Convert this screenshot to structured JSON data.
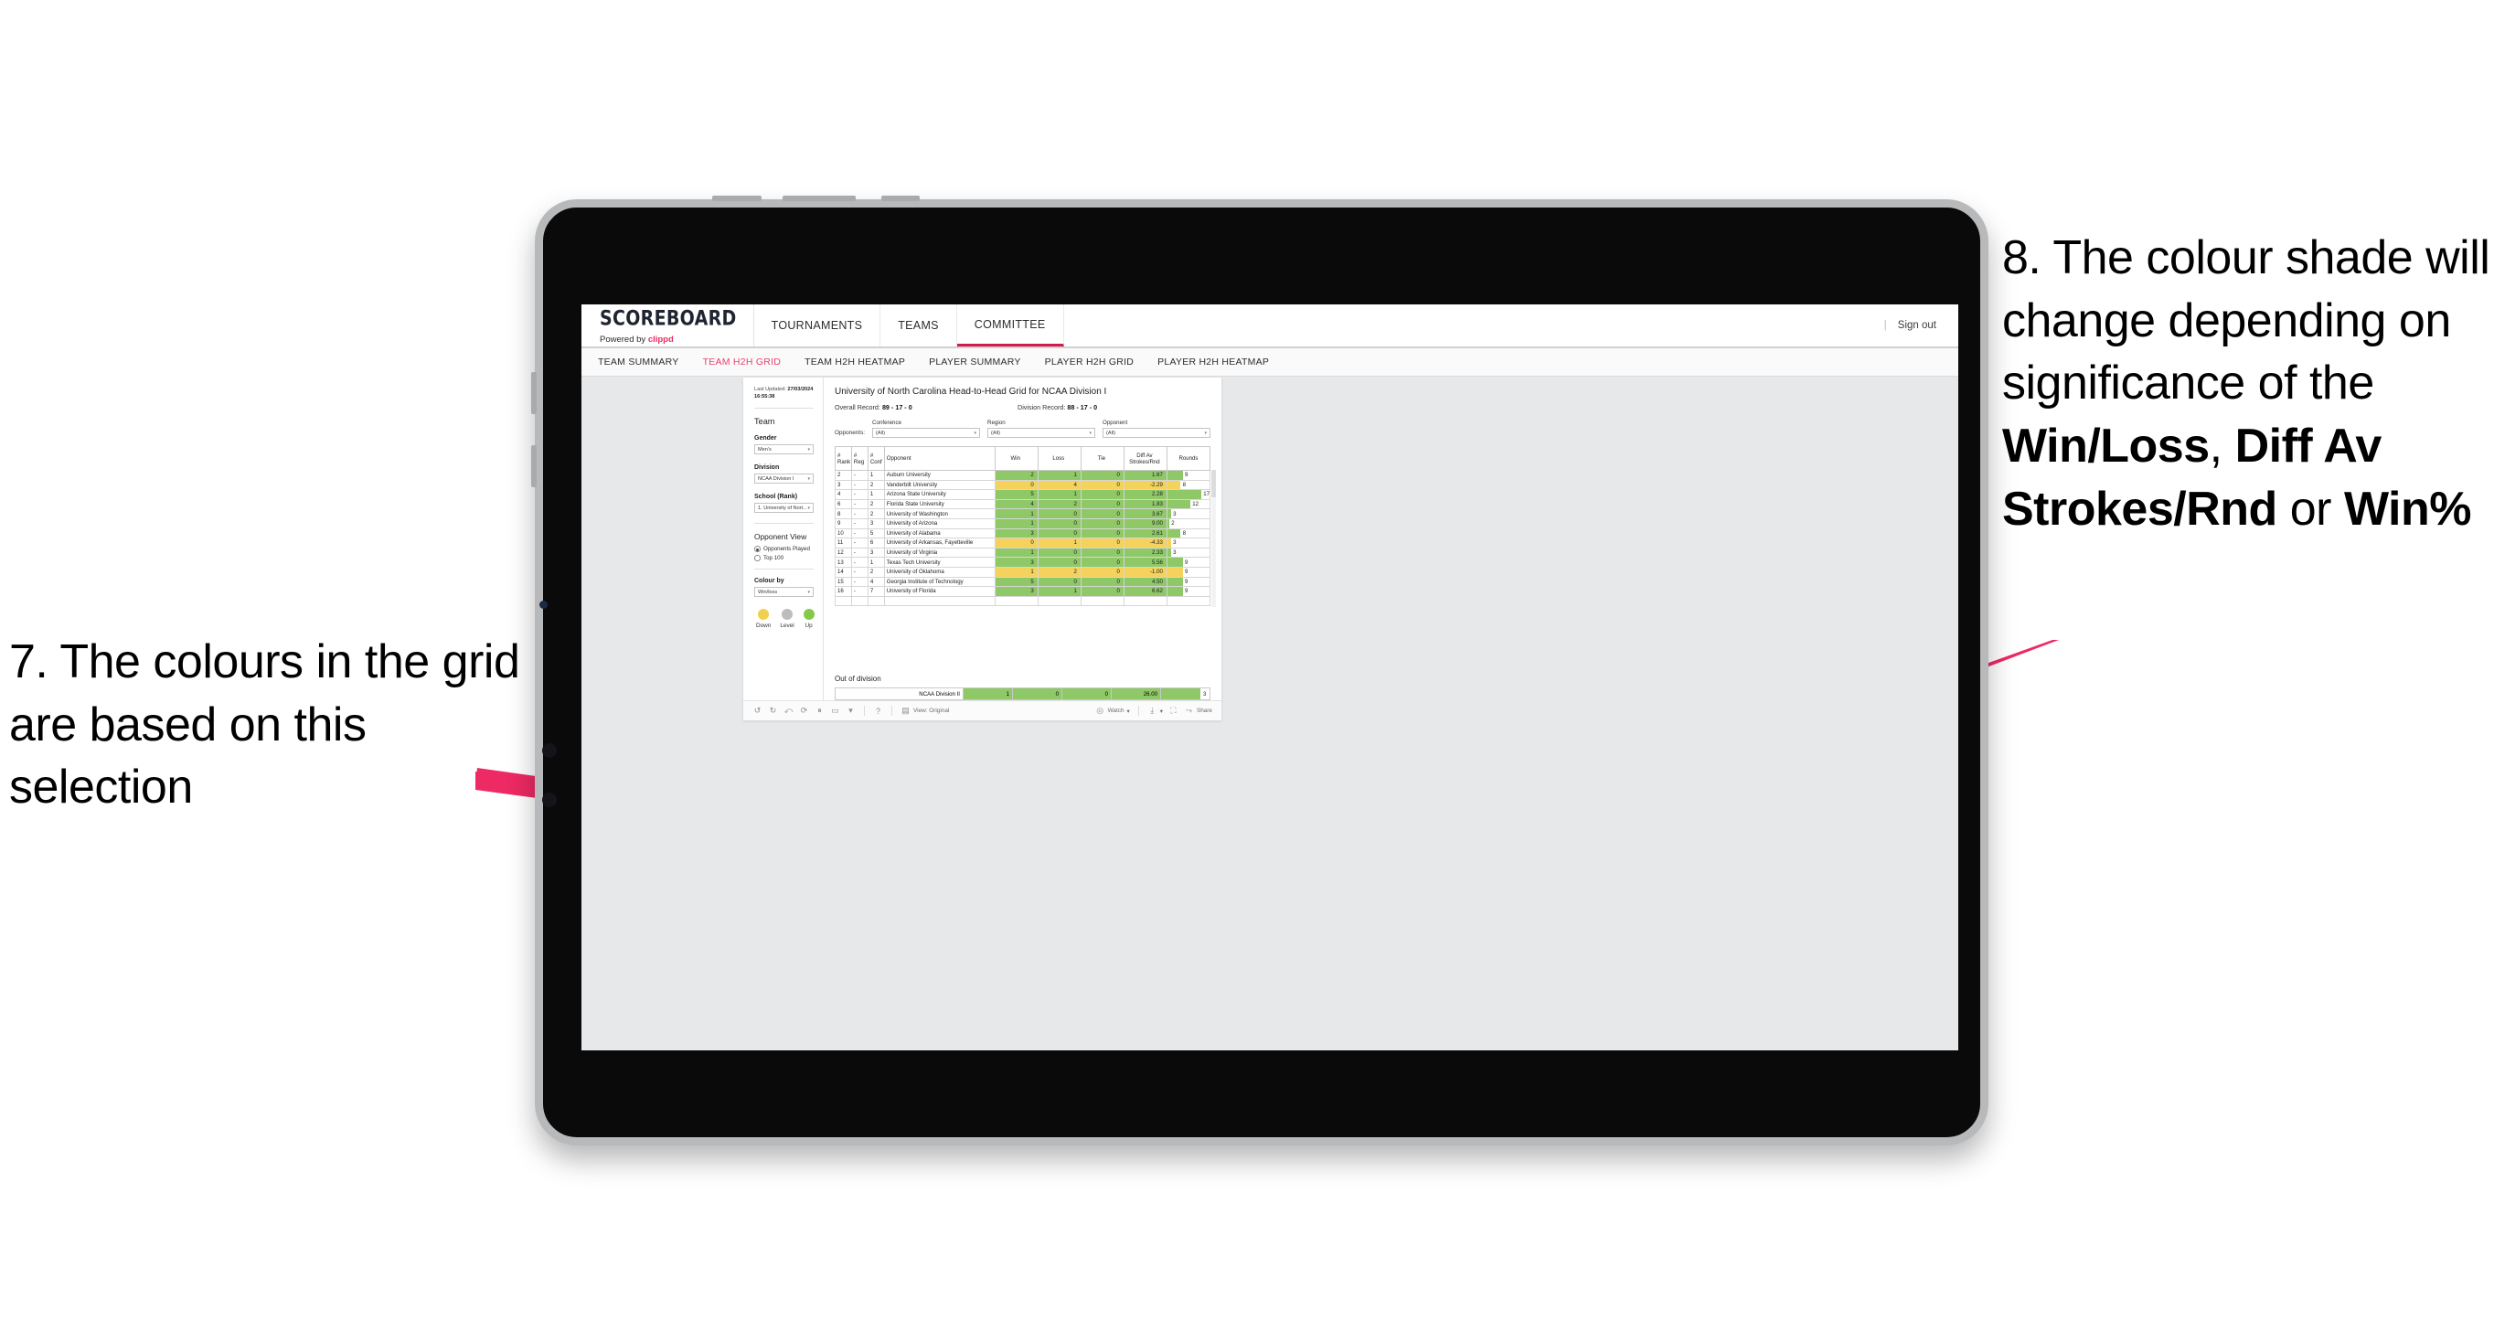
{
  "annotations": {
    "left": "7. The colours in the grid are based on this selection",
    "right_prefix": "8. The colour shade will change depending on significance of the ",
    "right_bold1": "Win/Loss",
    "right_mid1": ", ",
    "right_bold2": "Diff Av Strokes/Rnd",
    "right_mid2": " or ",
    "right_bold3": "Win%",
    "arrow_color": "#ED2A63"
  },
  "topnav": {
    "brand_title": "SCOREBOARD",
    "brand_sub_prefix": "Powered by ",
    "brand_sub_brand": "clippd",
    "items": [
      {
        "label": "TOURNAMENTS",
        "active": false
      },
      {
        "label": "TEAMS",
        "active": false
      },
      {
        "label": "COMMITTEE",
        "active": true
      }
    ],
    "divider": "|",
    "sign_out": "Sign out"
  },
  "subnav": {
    "items": [
      {
        "label": "TEAM SUMMARY",
        "active": false
      },
      {
        "label": "TEAM H2H GRID",
        "active": true
      },
      {
        "label": "TEAM H2H HEATMAP",
        "active": false
      },
      {
        "label": "PLAYER SUMMARY",
        "active": false
      },
      {
        "label": "PLAYER H2H GRID",
        "active": false
      },
      {
        "label": "PLAYER H2H HEATMAP",
        "active": false
      }
    ]
  },
  "sidebar": {
    "last_updated_label": "Last Updated: ",
    "last_updated_value": "27/03/2024 16:55:38",
    "team_heading": "Team",
    "gender_label": "Gender",
    "gender_value": "Men's",
    "division_label": "Division",
    "division_value": "NCAA Division I",
    "school_label": "School (Rank)",
    "school_value": "1. University of Nort...",
    "opponent_view_heading": "Opponent View",
    "opponent_view_options": [
      {
        "label": "Opponents Played",
        "selected": true
      },
      {
        "label": "Top 100",
        "selected": false
      }
    ],
    "colour_by_label": "Colour by",
    "colour_by_value": "Win/loss",
    "legend": [
      {
        "label": "Down",
        "color": "#F2D04F"
      },
      {
        "label": "Level",
        "color": "#BDBDBD"
      },
      {
        "label": "Up",
        "color": "#86C94A"
      }
    ]
  },
  "main": {
    "title": "University of North Carolina Head-to-Head Grid for NCAA Division I",
    "overall_record_label": "Overall Record: ",
    "overall_record_value": "89 - 17 - 0",
    "division_record_label": "Division Record: ",
    "division_record_value": "88 - 17 - 0",
    "opponents_label": "Opponents:",
    "filters": [
      {
        "label": "Conference",
        "value": "(All)"
      },
      {
        "label": "Region",
        "value": "(All)"
      },
      {
        "label": "Opponent",
        "value": "(All)"
      }
    ],
    "columns": [
      "# Rank",
      "# Reg",
      "# Conf",
      "Opponent",
      "Win",
      "Loss",
      "Tie",
      "Diff Av Strokes/Rnd",
      "Rounds"
    ],
    "col_rank_l1": "#",
    "col_rank_l2": "Rank",
    "col_reg_l1": "#",
    "col_reg_l2": "Reg",
    "col_conf_l1": "#",
    "col_conf_l2": "Conf",
    "col_opponent": "Opponent",
    "col_win": "Win",
    "col_loss": "Loss",
    "col_tie": "Tie",
    "col_diff_l1": "Diff Av",
    "col_diff_l2": "Strokes/Rnd",
    "col_rounds": "Rounds",
    "out_of_division_title": "Out of division",
    "out_of_division_row": {
      "name": "NCAA Division II",
      "win": "1",
      "loss": "0",
      "tie": "0",
      "diff": "26.00",
      "rounds": "3",
      "tone": "g",
      "rounds_pct": 85
    }
  },
  "chart_data": {
    "type": "table",
    "title": "University of North Carolina Head-to-Head Grid for NCAA Division I",
    "columns": [
      "# Rank",
      "# Reg",
      "# Conf",
      "Opponent",
      "Win",
      "Loss",
      "Tie",
      "Diff Av Strokes/Rnd",
      "Rounds"
    ],
    "colour_by": "Win/loss",
    "colour_scale": {
      "Down": "#F2D04F",
      "Level": "#BDBDBD",
      "Up": "#86C94A"
    },
    "rows": [
      {
        "rank": "2",
        "reg": "-",
        "conf": "1",
        "opponent": "Auburn University",
        "win": "2",
        "loss": "1",
        "tie": "0",
        "diff": "1.67",
        "rounds": "9",
        "tone": "g",
        "rounds_pct": 36
      },
      {
        "rank": "3",
        "reg": "-",
        "conf": "2",
        "opponent": "Vanderbilt University",
        "win": "0",
        "loss": "4",
        "tie": "0",
        "diff": "-2.29",
        "rounds": "8",
        "tone": "y",
        "rounds_pct": 31
      },
      {
        "rank": "4",
        "reg": "-",
        "conf": "1",
        "opponent": "Arizona State University",
        "win": "5",
        "loss": "1",
        "tie": "0",
        "diff": "2.28",
        "rounds": "17",
        "tone": "g",
        "rounds_pct": 80
      },
      {
        "rank": "6",
        "reg": "-",
        "conf": "2",
        "opponent": "Florida State University",
        "win": "4",
        "loss": "2",
        "tie": "0",
        "diff": "1.83",
        "rounds": "12",
        "tone": "g",
        "rounds_pct": 54
      },
      {
        "rank": "8",
        "reg": "-",
        "conf": "2",
        "opponent": "University of Washington",
        "win": "1",
        "loss": "0",
        "tie": "0",
        "diff": "3.67",
        "rounds": "3",
        "tone": "g",
        "rounds_pct": 8
      },
      {
        "rank": "9",
        "reg": "-",
        "conf": "3",
        "opponent": "University of Arizona",
        "win": "1",
        "loss": "0",
        "tie": "0",
        "diff": "9.00",
        "rounds": "2",
        "tone": "g",
        "rounds_pct": 4
      },
      {
        "rank": "10",
        "reg": "-",
        "conf": "5",
        "opponent": "University of Alabama",
        "win": "3",
        "loss": "0",
        "tie": "0",
        "diff": "2.61",
        "rounds": "8",
        "tone": "g",
        "rounds_pct": 31
      },
      {
        "rank": "11",
        "reg": "-",
        "conf": "6",
        "opponent": "University of Arkansas, Fayetteville",
        "win": "0",
        "loss": "1",
        "tie": "0",
        "diff": "-4.33",
        "rounds": "3",
        "tone": "y",
        "rounds_pct": 8
      },
      {
        "rank": "12",
        "reg": "-",
        "conf": "3",
        "opponent": "University of Virginia",
        "win": "1",
        "loss": "0",
        "tie": "0",
        "diff": "2.33",
        "rounds": "3",
        "tone": "g",
        "rounds_pct": 8
      },
      {
        "rank": "13",
        "reg": "-",
        "conf": "1",
        "opponent": "Texas Tech University",
        "win": "3",
        "loss": "0",
        "tie": "0",
        "diff": "5.56",
        "rounds": "9",
        "tone": "g",
        "rounds_pct": 36
      },
      {
        "rank": "14",
        "reg": "-",
        "conf": "2",
        "opponent": "University of Oklahoma",
        "win": "1",
        "loss": "2",
        "tie": "0",
        "diff": "-1.00",
        "rounds": "9",
        "tone": "y",
        "rounds_pct": 36
      },
      {
        "rank": "15",
        "reg": "-",
        "conf": "4",
        "opponent": "Georgia Institute of Technology",
        "win": "5",
        "loss": "0",
        "tie": "0",
        "diff": "4.50",
        "rounds": "9",
        "tone": "g",
        "rounds_pct": 36
      },
      {
        "rank": "16",
        "reg": "-",
        "conf": "7",
        "opponent": "University of Florida",
        "win": "3",
        "loss": "1",
        "tie": "0",
        "diff": "6.62",
        "rounds": "9",
        "tone": "g",
        "rounds_pct": 36
      }
    ],
    "out_of_division": [
      {
        "name": "NCAA Division II",
        "win": "1",
        "loss": "0",
        "tie": "0",
        "diff": "26.00",
        "rounds": "3",
        "tone": "g"
      }
    ]
  },
  "toolbar": {
    "undo": "↺",
    "redo": "↻",
    "revert": "⤺",
    "refresh": "⟳",
    "pause": "⏸",
    "rect": "▭",
    "caret": "▾",
    "help": "?",
    "view_label": "View: Original",
    "watch_label": "Watch",
    "download_caret": "▾",
    "share_label": "Share"
  }
}
